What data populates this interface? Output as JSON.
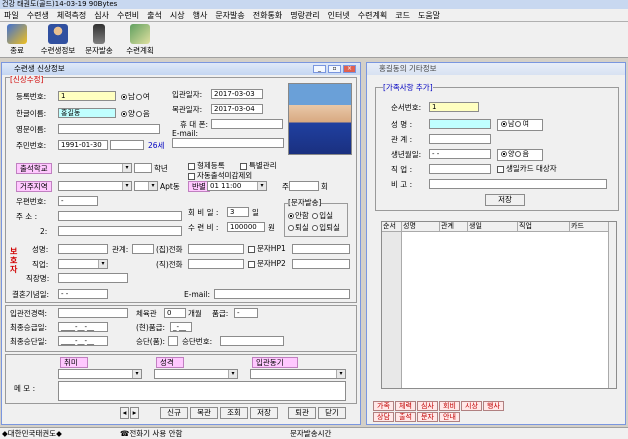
{
  "app": {
    "title": "건강 태권도(골드)14-03-19 90Bytes"
  },
  "menu": [
    "파일",
    "수련생",
    "체력측정",
    "심사",
    "수련비",
    "출석",
    "시상",
    "행사",
    "문자발송",
    "전화통화",
    "명랑관리",
    "인터넷",
    "수련계획",
    "코드",
    "도움말"
  ],
  "toolbar": {
    "exit": "종료",
    "member_info": "수련생정보",
    "sms": "문자발송",
    "plan": "수련계획"
  },
  "left": {
    "title": "수련생 신상정보",
    "section": "[신상수정]",
    "reg_no_label": "등록번호:",
    "reg_no": "1",
    "gender_m": "남",
    "gender_f": "여",
    "korean_name_label": "한글이름:",
    "korean_name": "홍길동",
    "solar": "양",
    "lunar": "음",
    "english_name_label": "영문이름:",
    "rrn_label": "주민번호:",
    "rrn": "1991-01-30",
    "age": "26세",
    "admission_label": "입관일자:",
    "admission": "2017-03-03",
    "readmission_label": "복관일자:",
    "readmission": "2017-03-04",
    "mobile_label": "휴 대 폰:",
    "email_label": "E-mail:",
    "school_label": "출석학교",
    "grade_label": "학년",
    "sibling": "형제등록",
    "special": "특별관리",
    "auto_absent": "자동출석미감제외",
    "area_label": "거주지역",
    "apt_label": "Apt동",
    "class_label": "반별",
    "class_value": "01 11:00",
    "week_label": "주",
    "week_unit": "회",
    "zip_label": "우편번호:",
    "zip": "-",
    "address_label": "주    소 :",
    "address2_label": "2:",
    "fee_day_label": "회 비 일 :",
    "fee_day": "3",
    "fee_day_unit": "일",
    "fee_label": "수 련 비 :",
    "fee": "100000",
    "fee_unit": "원",
    "sms_group": "[문자발송]",
    "sms_safe": "안함",
    "sms_in": "입실",
    "sms_out": "퇴실",
    "sms_inout": "입퇴실",
    "guardian_label": "보호자",
    "name_label": "성명:",
    "relation_label": "관계:",
    "home_phone_label": "(집)전화",
    "sms_hp1": "문자HP1",
    "job_label": "직업:",
    "work_phone_label": "(직)전화",
    "sms_hp2": "문자HP2",
    "workplace_label": "직장명:",
    "anniversary_label": "결혼기념일:",
    "anniversary": "-  -",
    "email2_label": "E-mail:",
    "level_label": "입관전경력:",
    "gym_label": "체육관",
    "gym_value": "0",
    "months_label": "개월",
    "dan_label": "품급:",
    "dan_value": "-",
    "last_promo_label": "최종승급일:",
    "last_promo": "____-__-__",
    "current_dan_label": "(현)품급:",
    "current_dan": "_-__",
    "last_exam_label": "최종승단일:",
    "last_exam": "____-__-__",
    "exam_dan_label": "승단(품):",
    "exam_no_label": "승단번호:",
    "hobby_label": "취미",
    "personality_label": "성격",
    "motive_label": "입관동기",
    "memo_label": "메    모 :",
    "btn_new": "신규",
    "btn_return": "복관",
    "btn_search": "조회",
    "btn_save": "저장",
    "btn_quit": "퇴관",
    "btn_close": "닫기"
  },
  "right": {
    "title": "홍길동의 기타정보",
    "section": "[가족사항 추가]",
    "seq_label": "순서번호:",
    "seq": "1",
    "name_label": "성    명 :",
    "gender_m": "남",
    "gender_f": "여",
    "relation_label": "관    계 :",
    "birth_label": "생년월일:",
    "birth": "-  -",
    "solar": "양",
    "lunar": "음",
    "job_label": "직    업 :",
    "birthday_card": "생일카드 대상자",
    "remark_label": "비    고 :",
    "save": "저장",
    "table_headers": [
      "순서",
      "성명",
      "관계",
      "생일",
      "직업",
      "카드"
    ],
    "tabs_row1": [
      "가족",
      "체력",
      "심사",
      "회비",
      "시상",
      "행사"
    ],
    "tabs_row2": [
      "상담",
      "출석",
      "문자",
      "안내"
    ]
  },
  "status": {
    "org": "◆대한민국태권도◆",
    "phone": "☎전화기 사용 안함",
    "sms_time": "문자발송시간"
  },
  "colors": {
    "accent": "#7a96df",
    "tag": "#ffc8ff",
    "input_yellow": "#ffffc0",
    "input_cyan": "#c0ffff"
  }
}
